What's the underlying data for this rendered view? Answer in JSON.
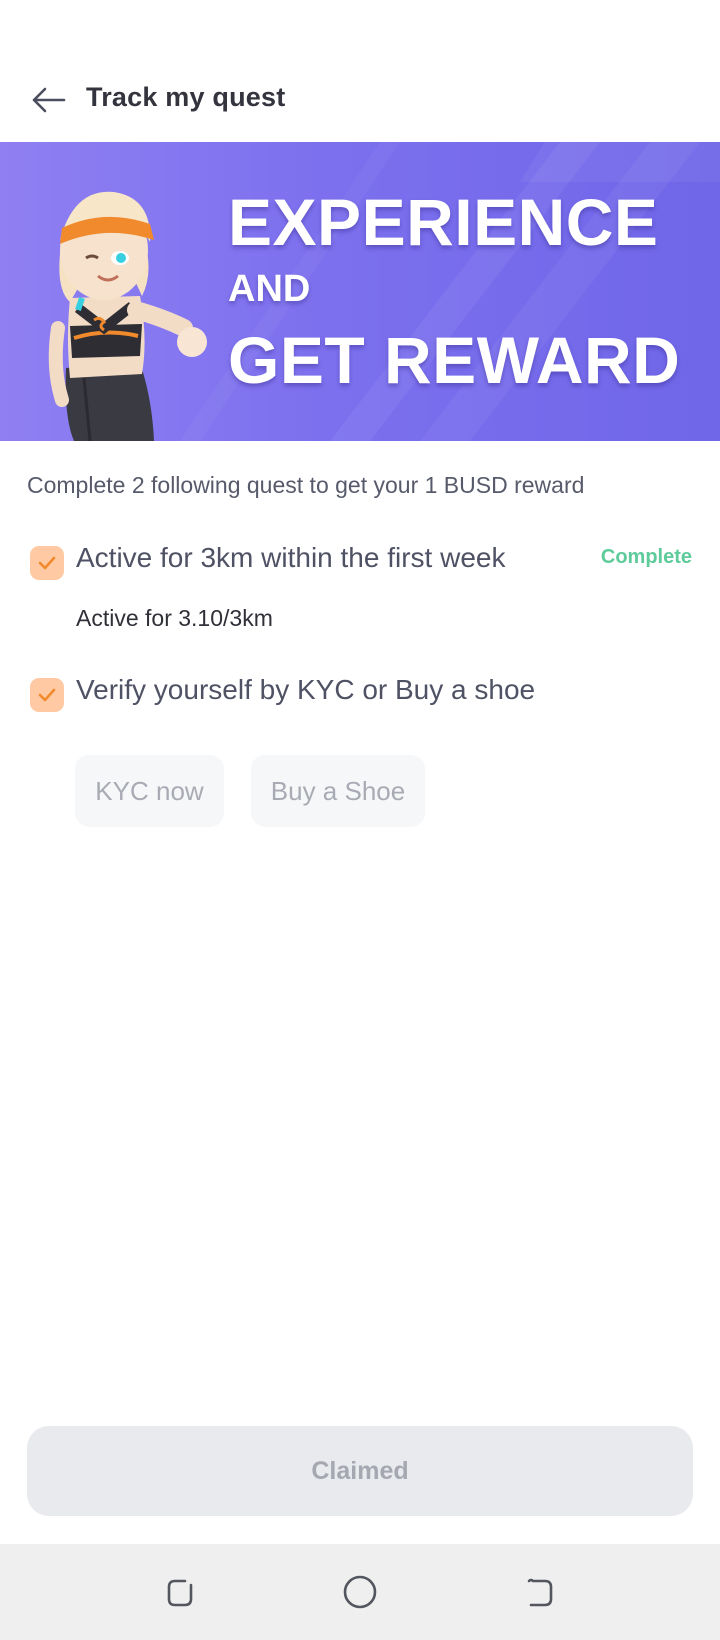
{
  "header": {
    "title": "Track my quest",
    "back_icon": "arrow-left-icon"
  },
  "banner": {
    "line1": "EXPERIENCE",
    "line2": "AND",
    "line3": "GET REWARD",
    "colors": {
      "start": "#8f7ff2",
      "end": "#6f66e8"
    }
  },
  "intro": "Complete 2 following quest to get your 1 BUSD reward",
  "quests": [
    {
      "title": "Active for 3km within the first week",
      "status": "Complete",
      "progress": "Active for 3.10/3km",
      "checked": true
    },
    {
      "title": "Verify yourself by KYC or Buy a shoe",
      "checked": true,
      "actions": [
        "KYC now",
        "Buy a Shoe"
      ]
    }
  ],
  "claim_button": "Claimed",
  "colors": {
    "checkbox": "#ffc9a3",
    "check": "#f08a2c",
    "status_green": "#5ecb9b",
    "banner": "#7c70ee"
  },
  "navbar": {
    "icons": [
      "recent-apps-icon",
      "home-icon",
      "back-icon"
    ]
  }
}
